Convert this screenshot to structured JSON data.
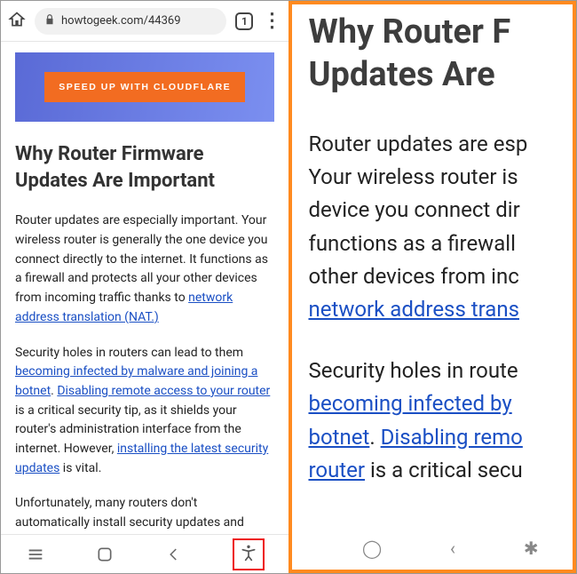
{
  "browser": {
    "url_display": "howtogeek.com/44369",
    "tab_count": "1"
  },
  "banner": {
    "cta": "SPEED UP WITH CLOUDFLARE"
  },
  "article": {
    "heading": "Why Router Firmware Updates Are Important",
    "p1_pre": "Router updates are especially important. Your wireless router is generally the one device you connect directly to the internet. It functions as a firewall and protects all your other devices from incoming traffic thanks to ",
    "p1_link": "network address translation (NAT.)",
    "p2_a": "Security holes in routers can lead to them ",
    "p2_link1": "becoming infected by malware and joining a botnet",
    "p2_b": ". ",
    "p2_link2": "Disabling remote access to your router",
    "p2_c": " is a critical security tip, as it shields your router's administration interface from the internet. However, ",
    "p2_link3": "installing the latest security updates",
    "p2_d": " is vital.",
    "p3": "Unfortunately, many routers don't automatically install security updates and"
  },
  "zoom": {
    "heading_l1": "Why Router F",
    "heading_l2": "Updates Are ",
    "p1_l1": "Router updates are esp",
    "p1_l2": "Your wireless router is",
    "p1_l3": "device you connect dir",
    "p1_l4": "functions as a firewall ",
    "p1_l5": "other devices from inc",
    "p1_link": "network address trans",
    "p2_l1": "Security holes in route",
    "p2_link1": "becoming infected by ",
    "p2_link2a": "botnet",
    "p2_mid": ". ",
    "p2_link2b": "Disabling remo",
    "p2_link3": "router",
    "p2_tail": " is a critical secu"
  }
}
